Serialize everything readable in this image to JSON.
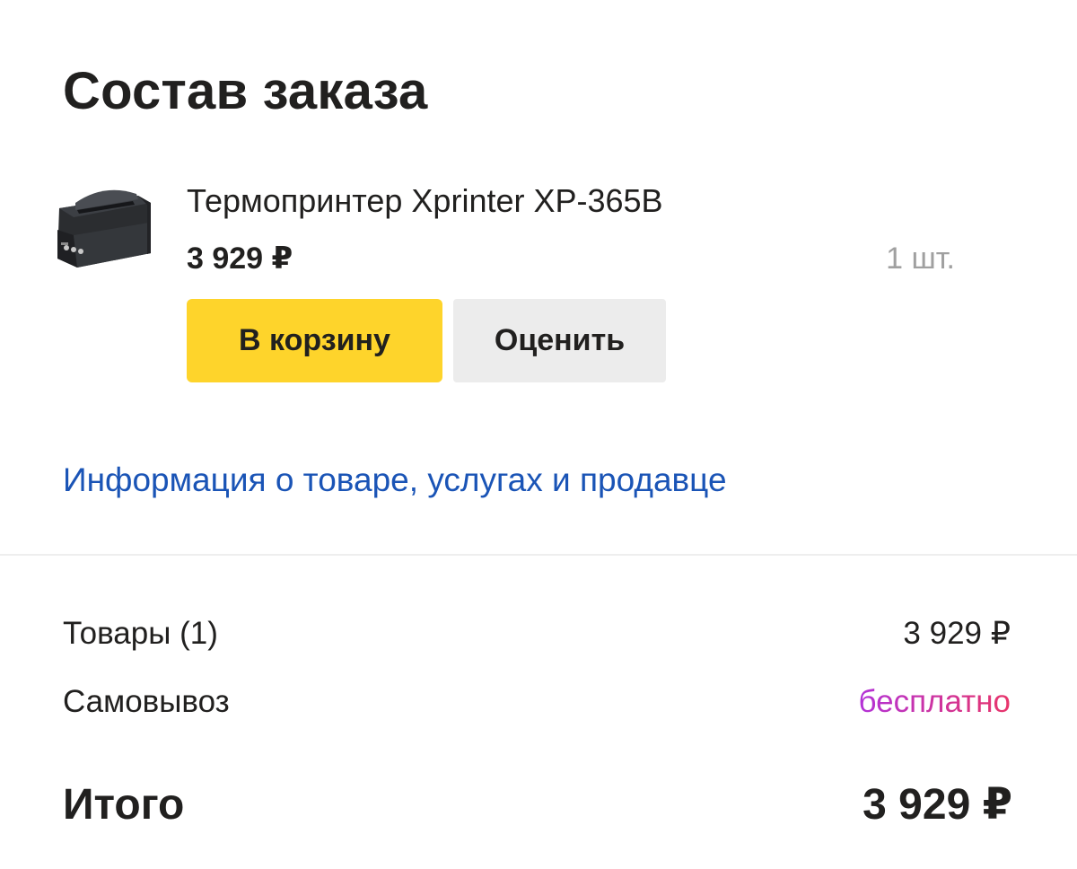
{
  "order": {
    "title": "Состав заказа",
    "product": {
      "name": "Термопринтер Xprinter XP-365B",
      "price": "3 929 ₽",
      "quantity": "1 шт.",
      "image_icon": "thermal-printer-icon"
    },
    "actions": {
      "add_to_cart_label": "В корзину",
      "rate_label": "Оценить"
    },
    "info_link": "Информация о товаре, услугах и продавце"
  },
  "summary": {
    "items_label": "Товары (1)",
    "items_value": "3 929 ₽",
    "pickup_label": "Самовывоз",
    "pickup_value": "бесплатно",
    "total_label": "Итого",
    "total_value": "3 929 ₽"
  },
  "colors": {
    "accent_button": "#fed42b",
    "secondary_button": "#ececec",
    "link": "#1a54b6",
    "muted": "#a0a0a0",
    "free_gradient_start": "#b232d8",
    "free_gradient_end": "#e8356a"
  }
}
